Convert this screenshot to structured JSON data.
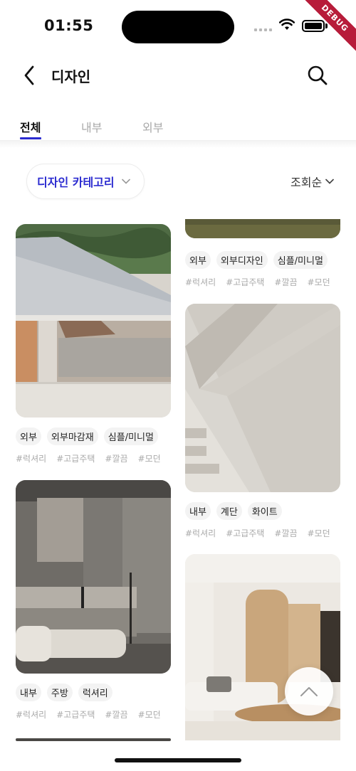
{
  "status_bar": {
    "time": "01:55",
    "debug_label": "DEBUG"
  },
  "header": {
    "title": "디자인",
    "back_icon": "chevron-left-icon",
    "search_icon": "search-icon"
  },
  "tabs": [
    {
      "label": "전체",
      "active": true
    },
    {
      "label": "내부",
      "active": false
    },
    {
      "label": "외부",
      "active": false
    }
  ],
  "filter": {
    "category_label": "디자인 카테고리",
    "sort_label": "조회순"
  },
  "accent_color": "#2b2bd0",
  "left_cards": [
    {
      "tags": [
        "외부",
        "외부마감재",
        "심플/미니멀"
      ],
      "hashtags": [
        "#럭셔리",
        "#고급주택",
        "#깔끔",
        "#모던"
      ]
    },
    {
      "tags": [
        "내부",
        "주방",
        "럭셔리"
      ],
      "hashtags": [
        "#럭셔리",
        "#고급주택",
        "#깔끔",
        "#모던"
      ]
    }
  ],
  "right_cards": [
    {
      "tags": [
        "외부",
        "외부디자인",
        "심플/미니멀"
      ],
      "hashtags": [
        "#럭셔리",
        "#고급주택",
        "#깔끔",
        "#모던"
      ]
    },
    {
      "tags": [
        "내부",
        "계단",
        "화이트"
      ],
      "hashtags": [
        "#럭셔리",
        "#고급주택",
        "#깔끔",
        "#모던"
      ]
    }
  ]
}
